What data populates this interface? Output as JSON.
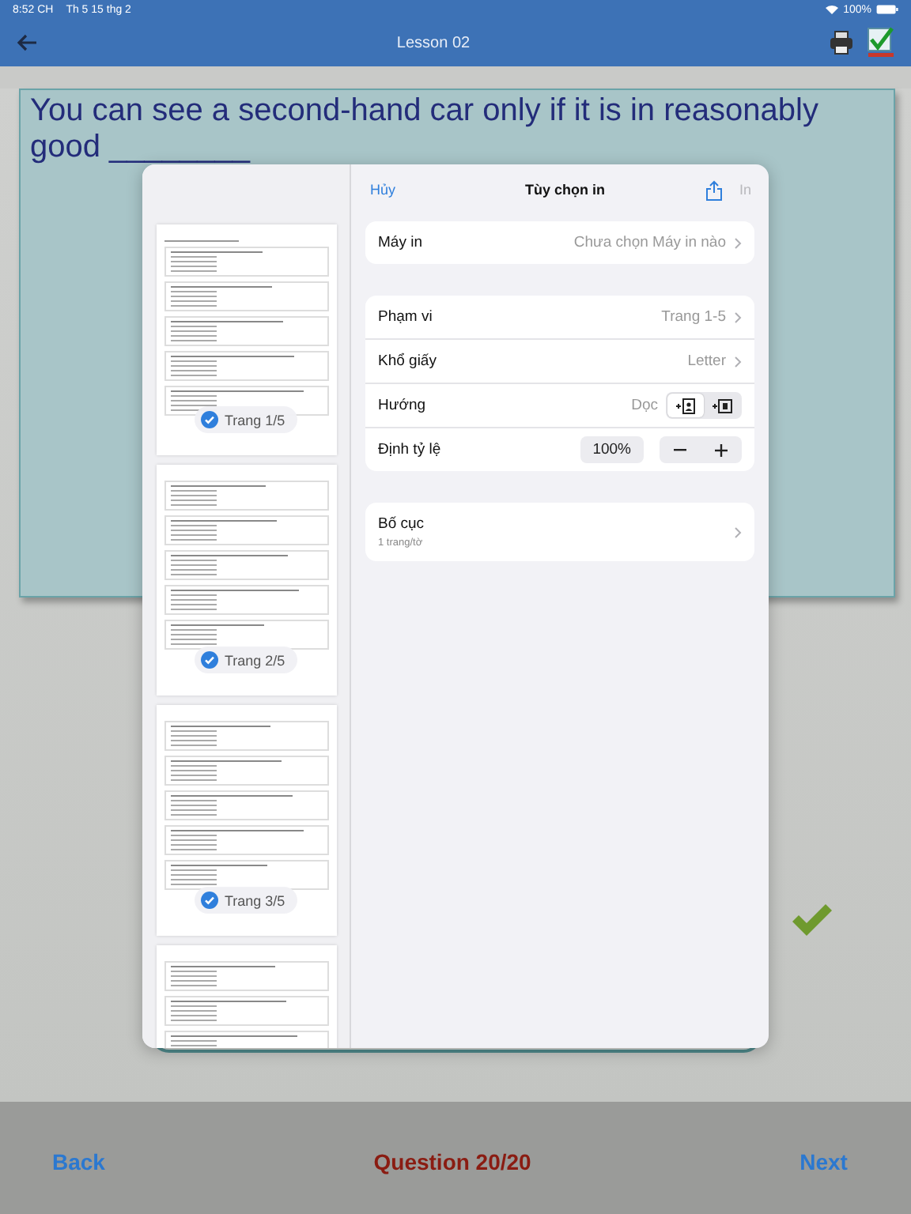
{
  "status_bar": {
    "time": "8:52 CH",
    "date": "Th 5 15 thg 2",
    "battery": "100%"
  },
  "nav": {
    "title": "Lesson 02"
  },
  "question": {
    "text": "You can see a second-hand car only if it is in reasonably good ________"
  },
  "print_dialog": {
    "cancel": "Hủy",
    "title": "Tùy chọn in",
    "print": {
      "label": "In",
      "disabled": true
    },
    "pages": [
      {
        "kind": "page",
        "badge": "Trang 1/5",
        "selected": true
      },
      {
        "kind": "page",
        "badge": "Trang 2/5",
        "selected": true
      },
      {
        "kind": "page",
        "badge": "Trang 3/5",
        "selected": true
      },
      {
        "kind": "page"
      }
    ],
    "groups": [
      {
        "rows": [
          {
            "kind": "link",
            "label": "Máy in",
            "value": "Chưa chọn Máy in nào"
          }
        ]
      },
      {
        "rows": [
          {
            "kind": "link",
            "label": "Phạm vi",
            "value": "Trang 1-5"
          },
          {
            "kind": "link",
            "label": "Khổ giấy",
            "value": "Letter"
          },
          {
            "kind": "orientation",
            "label": "Hướng",
            "value": "Dọc",
            "options": [
              {
                "kind": "portrait",
                "selected": true
              },
              {
                "kind": "landscape",
                "selected": false
              }
            ]
          },
          {
            "kind": "scale",
            "label": "Định tỷ lệ",
            "value": "100%"
          }
        ]
      },
      {
        "rows": [
          {
            "kind": "link",
            "label": "Bố cục",
            "subtitle": "1 trang/tờ"
          }
        ]
      }
    ]
  },
  "footer": {
    "back": "Back",
    "question": "Question 20/20",
    "next": "Next"
  }
}
